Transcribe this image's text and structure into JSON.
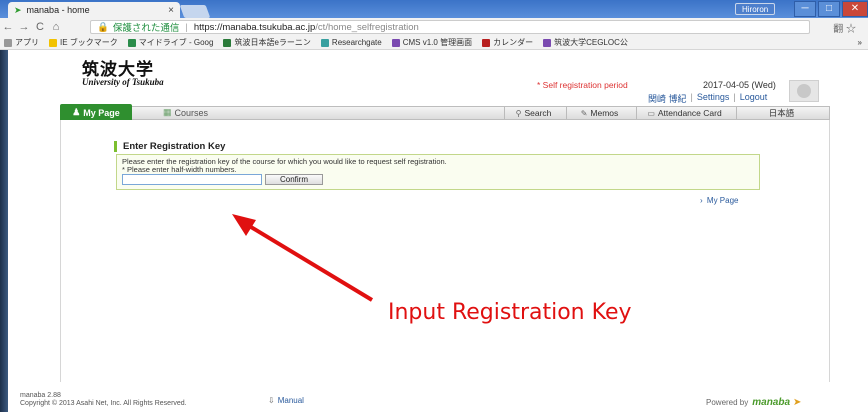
{
  "browser": {
    "tab_title": "manaba - home",
    "tab_close": "×",
    "user_badge": "Hiroron",
    "win_min": "─",
    "win_max": "□",
    "win_close": "✕",
    "nav_back": "←",
    "nav_forward": "→",
    "nav_reload": "C",
    "nav_home": "⌂",
    "secure_label": "保護された通信",
    "url_host": "https://manaba.tsukuba.ac.jp",
    "url_path": "/ct/home_selfregistration",
    "translate_icon": "翻",
    "star_icon": "☆",
    "bookmarks": [
      {
        "label": "アプリ",
        "color": "#999999"
      },
      {
        "label": "IE ブックマーク",
        "color": "#f2c200"
      },
      {
        "label": "マイドライブ - Goog",
        "color": "#2a8c4a"
      },
      {
        "label": "筑波日本語eラーニン",
        "color": "#2a7a3a"
      },
      {
        "label": "Researchgate",
        "color": "#38a0a0"
      },
      {
        "label": "CMS v1.0 管理画面",
        "color": "#7a4ab0"
      },
      {
        "label": "カレンダー",
        "color": "#b82020"
      },
      {
        "label": "筑波大学CEGLOC公",
        "color": "#7a4ab0"
      }
    ],
    "more_bookmarks": "»"
  },
  "header": {
    "logo_jp": "筑波大学",
    "logo_en": "University of Tsukuba",
    "selfreg_notice": "* Self registration period",
    "date": "2017-04-05 (Wed)",
    "user_name": "関崎 博紀",
    "settings": "Settings",
    "logout": "Logout",
    "separator": "|"
  },
  "nav": {
    "mypage": "My Page",
    "courses": "Courses",
    "search": "Search",
    "memos": "Memos",
    "attendance": "Attendance Card",
    "language": "日本語"
  },
  "main": {
    "section_title": "Enter Registration Key",
    "instruction1": "Please enter the registration key of the course for which you would like to request self registration.",
    "instruction2": "* Please enter half-width numbers.",
    "input_value": "",
    "confirm_label": "Confirm",
    "mypage_link": "My Page",
    "mypage_chevron": "›"
  },
  "annotation": {
    "text": "Input Registration Key",
    "color": "#e01010"
  },
  "footer": {
    "version": "manaba 2.88",
    "copyright": "Copyright © 2013 Asahi Net, Inc. All Rights Reserved.",
    "manual": "Manual",
    "powered_by": "Powered by",
    "brand": "manaba"
  }
}
